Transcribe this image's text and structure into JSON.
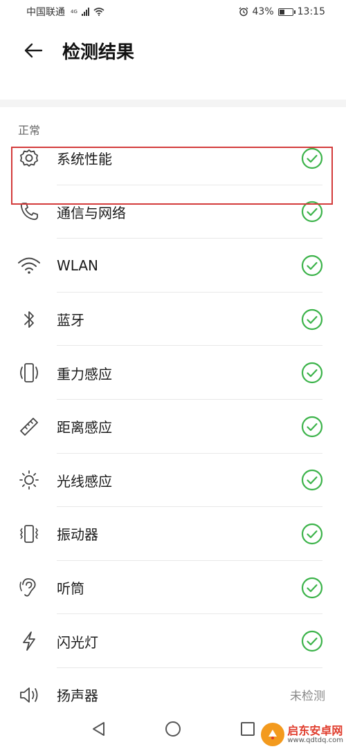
{
  "status_bar": {
    "carrier": "中国联通",
    "network": "4G",
    "battery_percent": "43%",
    "battery_level": 0.43,
    "time": "13:15"
  },
  "header": {
    "title": "检测结果"
  },
  "section": {
    "label": "正常"
  },
  "items": [
    {
      "label": "系统性能",
      "icon": "gear-icon"
    },
    {
      "label": "通信与网络",
      "icon": "phone-icon"
    },
    {
      "label": "WLAN",
      "icon": "wifi-icon"
    },
    {
      "label": "蓝牙",
      "icon": "bluetooth-icon"
    },
    {
      "label": "重力感应",
      "icon": "gravity-sensor-icon"
    },
    {
      "label": "距离感应",
      "icon": "ruler-icon"
    },
    {
      "label": "光线感应",
      "icon": "sun-icon"
    },
    {
      "label": "振动器",
      "icon": "vibration-icon"
    },
    {
      "label": "听筒",
      "icon": "ear-icon"
    },
    {
      "label": "闪光灯",
      "icon": "flash-icon"
    },
    {
      "label": "扬声器",
      "icon": "speaker-icon",
      "status_text": "未检测"
    }
  ],
  "watermark": {
    "title": "启东安卓网",
    "url": "www.qdtdq.com"
  },
  "colors": {
    "check_green": "#3cb34a",
    "highlight_red": "#d33a3a",
    "icon_gray": "#444444"
  }
}
